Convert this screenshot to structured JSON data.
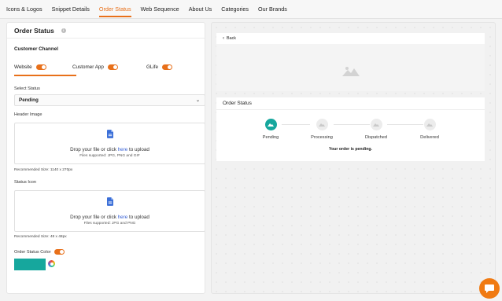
{
  "nav": {
    "tabs": [
      "Icons & Logos",
      "Snippet Details",
      "Order Status",
      "Web Sequence",
      "About Us",
      "Categories",
      "Our Brands"
    ],
    "active_index": 2
  },
  "left": {
    "title": "Order Status",
    "info_icon_char": "i",
    "customer_channel_label": "Customer Channel",
    "channels": [
      {
        "label": "Website",
        "enabled": true
      },
      {
        "label": "Customer App",
        "enabled": true
      },
      {
        "label": "GLife",
        "enabled": true
      }
    ],
    "select_status_label": "Select Status",
    "select_status_value": "Pending",
    "header_image_label": "Header Image",
    "header_upload": {
      "text_before": "Drop your file or click ",
      "link": "here",
      "text_after": " to upload",
      "supported": "Files supported: JPG, PNG and GIF"
    },
    "header_recommended": "Recommended Size: 1140 x 270px",
    "status_icon_label": "Status Icon",
    "icon_upload": {
      "text_before": "Drop your file or click ",
      "link": "here",
      "text_after": " to upload",
      "supported": "Files supported: JPG and PNG"
    },
    "icon_recommended": "Recommended Size: 48 x 48px",
    "order_status_color_label": "Order Status Color",
    "order_status_color_enabled": true,
    "order_status_color": "#16a79d"
  },
  "preview": {
    "back_label": "Back",
    "card_title": "Order Status",
    "steps": [
      {
        "label": "Pending",
        "done": true
      },
      {
        "label": "Processing",
        "done": false
      },
      {
        "label": "Dispatched",
        "done": false
      },
      {
        "label": "Delivered",
        "done": false
      }
    ],
    "message": "Your order is pending."
  },
  "colors": {
    "accent": "#e8701a",
    "teal": "#16a79d",
    "link": "#3a63d6"
  },
  "icons": [
    "info-icon",
    "chevron-down-icon",
    "file-upload-icon",
    "image-placeholder-icon",
    "back-arrow-icon",
    "color-picker-icon",
    "chat-icon"
  ]
}
